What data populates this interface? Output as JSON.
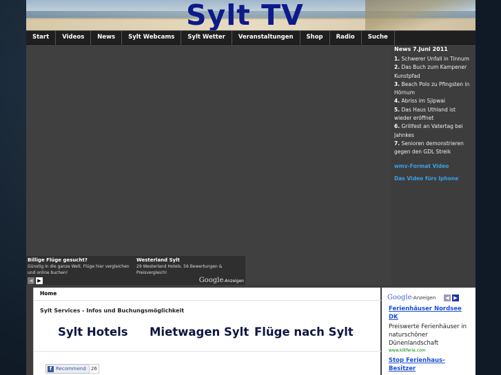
{
  "site": {
    "title": "Sylt TV"
  },
  "nav": {
    "items": [
      "Start",
      "Videos",
      "News",
      "Sylt Webcams",
      "Sylt Wetter",
      "Veranstaltungen",
      "Shop",
      "Radio",
      "Suche"
    ]
  },
  "video_ads": {
    "ad1": {
      "title": "Billige Flüge gesucht?",
      "text": "Günstig in die ganze Welt. Flüge hier vergleichen und online buchen!"
    },
    "ad2": {
      "title": "Westerland Sylt",
      "text": "29 Westerland Hotels. 56 Bewertungen & Preisvergleich!"
    },
    "prev_icon": "chevron-left-icon",
    "next_icon": "chevron-right-icon",
    "google_label": "Google",
    "anzeigen_label": "-Anzeigen"
  },
  "news": {
    "title": "News 7.Juni 2011",
    "items": [
      {
        "num": "1.",
        "text": "Schwerer Unfall in Tinnum"
      },
      {
        "num": "2.",
        "text": "Das Buch zum Kampener Kunstpfad"
      },
      {
        "num": "3.",
        "text": "Beach Polo zu Pfingsten in Hörnum"
      },
      {
        "num": "4.",
        "text": "Abriss im Sjipwai"
      },
      {
        "num": "5.",
        "text": "Das Haus Uthland ist wieder eröffnet"
      },
      {
        "num": "6.",
        "text": "Grillfest an Vatertag bei Jahnkes"
      },
      {
        "num": "7.",
        "text": "Senioren demonstrieren gegen den GDL Streik"
      }
    ],
    "link_wmv": "wmv-Format Video",
    "link_iphone": "Das Video fürs Iphone"
  },
  "content": {
    "breadcrumb": "Home",
    "services_title": "Sylt Services - Infos und Buchungsmöglichkeit",
    "services": [
      "Sylt Hotels",
      "Mietwagen Sylt",
      "Flüge nach Sylt"
    ],
    "fb_recommend": "Recommend",
    "fb_count": "26"
  },
  "right_ads": {
    "google_label": "Google",
    "anzeigen_label": "-Anzeigen",
    "ad1": {
      "title": "Ferienhäuser Nordsee DK",
      "text": "Preiswerte Ferienhäuser in naturschöner Dünenlandschaft",
      "url": "www.klitferie.com"
    },
    "ad2": {
      "title": "Stop Ferienhaus-Besitzer"
    }
  },
  "colors": {
    "title": "#0d1a8a",
    "nav_bg": "#1f1f1f",
    "link_blue": "#3aa0e8",
    "ad_link": "#1a4fd0"
  }
}
